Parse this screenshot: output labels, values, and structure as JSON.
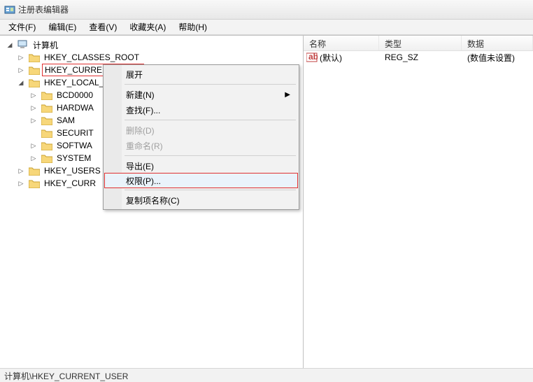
{
  "window": {
    "title": "注册表编辑器"
  },
  "menu": {
    "file": "文件(F)",
    "edit": "编辑(E)",
    "view": "查看(V)",
    "favorites": "收藏夹(A)",
    "help": "帮助(H)"
  },
  "tree": {
    "root": "计算机",
    "items": [
      "HKEY_CLASSES_ROOT",
      "HKEY_CURRENT_USER",
      "HKEY_LOCAL_MACHINE"
    ],
    "hklm_children": [
      "BCD0000",
      "HARDWA",
      "SAM",
      "SECURIT",
      "SOFTWA",
      "SYSTEM"
    ],
    "tail": [
      "HKEY_USERS",
      "HKEY_CURR"
    ]
  },
  "context_menu": {
    "expand": "展开",
    "new": "新建(N)",
    "find": "查找(F)...",
    "delete": "删除(D)",
    "rename": "重命名(R)",
    "export": "导出(E)",
    "permissions": "权限(P)...",
    "copy_key_name": "复制项名称(C)"
  },
  "list": {
    "headers": {
      "name": "名称",
      "type": "类型",
      "data": "数据"
    },
    "rows": [
      {
        "icon": "ab",
        "name": "(默认)",
        "type": "REG_SZ",
        "data": "(数值未设置)"
      }
    ]
  },
  "status": "计算机\\HKEY_CURRENT_USER",
  "colors": {
    "highlight_border": "#e03030"
  }
}
